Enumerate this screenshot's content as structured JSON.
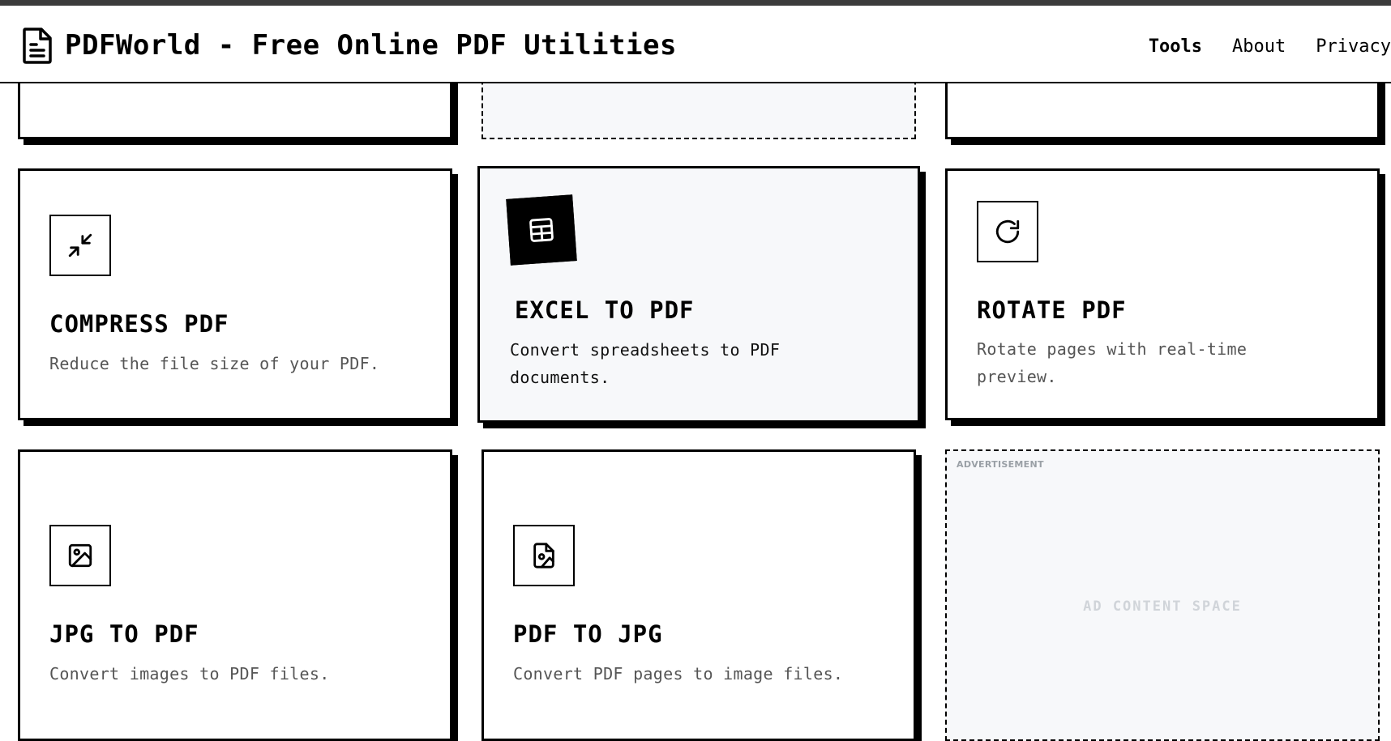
{
  "header": {
    "title": "PDFWorld - Free Online PDF Utilities",
    "nav": [
      {
        "label": "Tools",
        "active": true
      },
      {
        "label": "About",
        "active": false
      },
      {
        "label": "Privacy",
        "active": false
      }
    ]
  },
  "tools": [
    {
      "title": "COMPRESS PDF",
      "description": "Reduce the file size of your PDF.",
      "icon": "compress-icon"
    },
    {
      "title": "EXCEL TO PDF",
      "description": "Convert spreadsheets to PDF documents.",
      "icon": "spreadsheet-icon"
    },
    {
      "title": "ROTATE PDF",
      "description": "Rotate pages with real-time preview.",
      "icon": "rotate-icon"
    },
    {
      "title": "JPG TO PDF",
      "description": "Convert images to PDF files.",
      "icon": "image-icon"
    },
    {
      "title": "PDF TO JPG",
      "description": "Convert PDF pages to image files.",
      "icon": "image-file-icon"
    }
  ],
  "ad": {
    "label": "ADVERTISEMENT",
    "content": "AD CONTENT SPACE"
  },
  "colors": {
    "border": "#000000",
    "highlight_bg": "#f7f8fa",
    "desc_text": "#555555",
    "topstrip": "#3b3b3b"
  }
}
